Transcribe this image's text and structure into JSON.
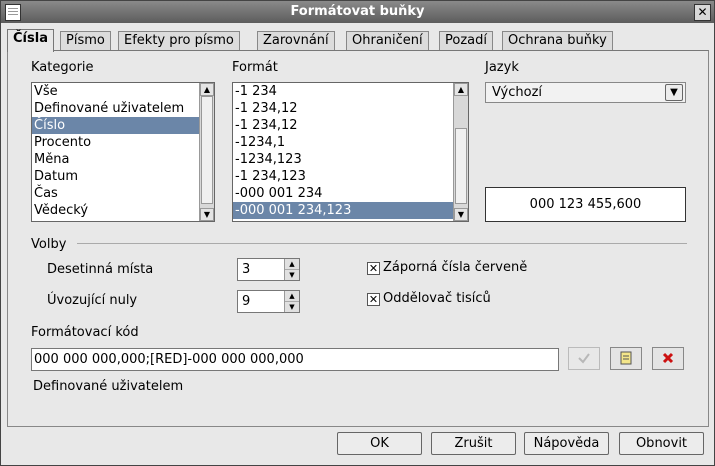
{
  "window": {
    "title": "Formátovat buňky",
    "close_glyph": "✕"
  },
  "tabs": [
    {
      "label": "Čísla"
    },
    {
      "label": "Písmo"
    },
    {
      "label": "Efekty pro písmo"
    },
    {
      "label": "Zarovnání"
    },
    {
      "label": "Ohraničení"
    },
    {
      "label": "Pozadí"
    },
    {
      "label": "Ochrana buňky"
    }
  ],
  "category": {
    "label": "Kategorie",
    "items": [
      "Vše",
      "Definované uživatelem",
      "Číslo",
      "Procento",
      "Měna",
      "Datum",
      "Čas",
      "Vědecký"
    ],
    "selected_index": 2
  },
  "format": {
    "label": "Formát",
    "items": [
      "-1 234",
      "-1 234,12",
      "-1 234,12",
      "-1234,1",
      "-1234,123",
      "-1 234,123",
      "-000 001 234",
      "-000 001 234,123"
    ],
    "selected_index": 7
  },
  "language": {
    "label": "Jazyk",
    "value": "Výchozí"
  },
  "preview": {
    "value": "000 123 455,600"
  },
  "options": {
    "label": "Volby",
    "decimal_places": {
      "label": "Desetinná místa",
      "value": "3"
    },
    "leading_zeros": {
      "label": "Úvozující nuly",
      "value": "9"
    },
    "negative_red": {
      "label": "Záporná čísla červeně",
      "checked": true
    },
    "thousands_sep": {
      "label": "Oddělovač tisíců",
      "checked": true
    }
  },
  "format_code": {
    "label": "Formátovací kód",
    "value": "000 000 000,000;[RED]-000 000 000,000",
    "comment": "Definované uživatelem"
  },
  "buttons": {
    "ok": "OK",
    "cancel": "Zrušit",
    "help": "Nápověda",
    "reset": "Obnovit"
  },
  "colors": {
    "selection": "#6b86a8",
    "title_bar": "#6e6e6e",
    "delete_icon": "#cc1111"
  }
}
